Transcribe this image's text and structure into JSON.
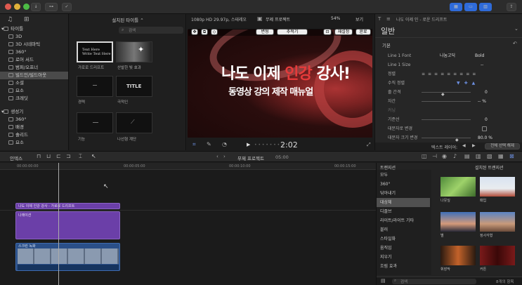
{
  "colors": {
    "accent": "#2f6bd9",
    "clip_purple": "#6b3fa8",
    "title_red": "#e63b3b"
  },
  "library": {
    "items": [
      {
        "label": "타이틀",
        "icon": "folder-icon",
        "expanded": true
      },
      {
        "label": "3D",
        "icon": "title-icon"
      },
      {
        "label": "3D 시네마틱",
        "icon": "title-icon"
      },
      {
        "label": "360°",
        "icon": "title-icon"
      },
      {
        "label": "로어 서드",
        "icon": "title-icon"
      },
      {
        "label": "범퍼/오프너",
        "icon": "title-icon"
      },
      {
        "label": "빌드인/빌드아웃",
        "icon": "title-icon",
        "selected": true
      },
      {
        "label": "소셜",
        "icon": "title-icon"
      },
      {
        "label": "요소",
        "icon": "title-icon"
      },
      {
        "label": "크레딧",
        "icon": "title-icon"
      },
      {
        "label": "생성기",
        "icon": "folder-icon",
        "expanded": true
      },
      {
        "label": "360°",
        "icon": "title-icon"
      },
      {
        "label": "배경",
        "icon": "title-icon"
      },
      {
        "label": "솔리드",
        "icon": "title-icon"
      },
      {
        "label": "요소",
        "icon": "title-icon"
      }
    ]
  },
  "browser": {
    "header": "설치된 타이틀 ⌃",
    "search_placeholder": "검색",
    "thumbs": [
      {
        "label": "가로로 드리프트",
        "text": "Text Here\nWrite Text Here"
      },
      {
        "label": "산발한 빛 효과",
        "text": ""
      },
      {
        "label": "경력",
        "text": ""
      },
      {
        "label": "극적인",
        "text": "TITLE"
      },
      {
        "label": "기능",
        "text": ""
      },
      {
        "label": "나선형 계단",
        "text": ""
      }
    ]
  },
  "viewer": {
    "format": "1080p HD 29.97p, 스테레오",
    "project": "무제 프로젝트",
    "zoom": "54%",
    "view": "보기",
    "title_main_a": "나도 이제",
    "title_main_b": "인강",
    "title_main_c": "강사!",
    "title_sub": "동영상 강의 제작 매뉴얼",
    "btn_change": "변형",
    "btn_apply": "추적기",
    "btn_done": "완료",
    "btn_reset": "재설정",
    "timecode": "2:02"
  },
  "inspector": {
    "clip_name": "나도 이제 인 - 로운 드리프트",
    "tab_title": "일반",
    "section_basic": "기본",
    "rows": [
      {
        "label": "Line 1 Font",
        "value": "나눔고딕",
        "value2": "Bold"
      },
      {
        "label": "Line 1 Size",
        "value": "--"
      },
      {
        "label": "정렬",
        "value": ""
      },
      {
        "label": "수직 정렬",
        "value": ""
      },
      {
        "label": "줄 간격",
        "value": "0"
      },
      {
        "label": "자간",
        "value": "-- %"
      },
      {
        "label": "커닝",
        "value": ""
      },
      {
        "label": "기준선",
        "value": "0"
      },
      {
        "label": "대문자로 변경",
        "value": ""
      },
      {
        "label": "대문자 크기 변경",
        "value": "80.0 %"
      }
    ],
    "footer_label": "텍스트 레이어:",
    "footer_btn": "전체 선택 해제"
  },
  "timeline": {
    "index": "인덱스",
    "project": "무제 프로젝트",
    "duration": "05:00",
    "ruler": [
      "00:00:00:00",
      "00:00:05:00",
      "00:00:10:00",
      "00:00:15:00"
    ],
    "title_clip": "나도 이제 인강 강사 - 가로로 드리프트",
    "video_clip": "나래이션",
    "audio_clip": "스크린 녹화"
  },
  "transitions": {
    "header": "트랜지션",
    "installed": "설치된 트랜지션",
    "categories": [
      "모두",
      "360°",
      "닦아내기",
      "디졸브",
      "대상체",
      "라이트/라이트 기타",
      "블러",
      "스타일화",
      "움직임",
      "지우기",
      "흐림 효과"
    ],
    "selected": "대상체",
    "items": [
      "나뭇잎",
      "패입",
      "별",
      "정사각형",
      "휘장막",
      "커튼"
    ],
    "search_placeholder": "검색",
    "count": "8개의 항목"
  }
}
